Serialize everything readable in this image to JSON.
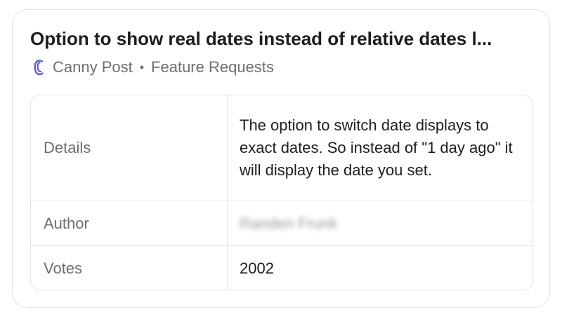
{
  "card": {
    "title": "Option to show real dates instead of relative dates l...",
    "source": "Canny Post",
    "separator": "•",
    "category": "Feature Requests",
    "logo_icon": "canny-logo-icon",
    "accent_color": "#5b5bd6"
  },
  "table": {
    "rows": [
      {
        "label": "Details",
        "value": "The option to switch date displays to exact dates. So instead of \"1 day ago\" it will display the date you set."
      },
      {
        "label": "Author",
        "value": "Randen Frunk"
      },
      {
        "label": "Votes",
        "value": "2002"
      }
    ]
  }
}
